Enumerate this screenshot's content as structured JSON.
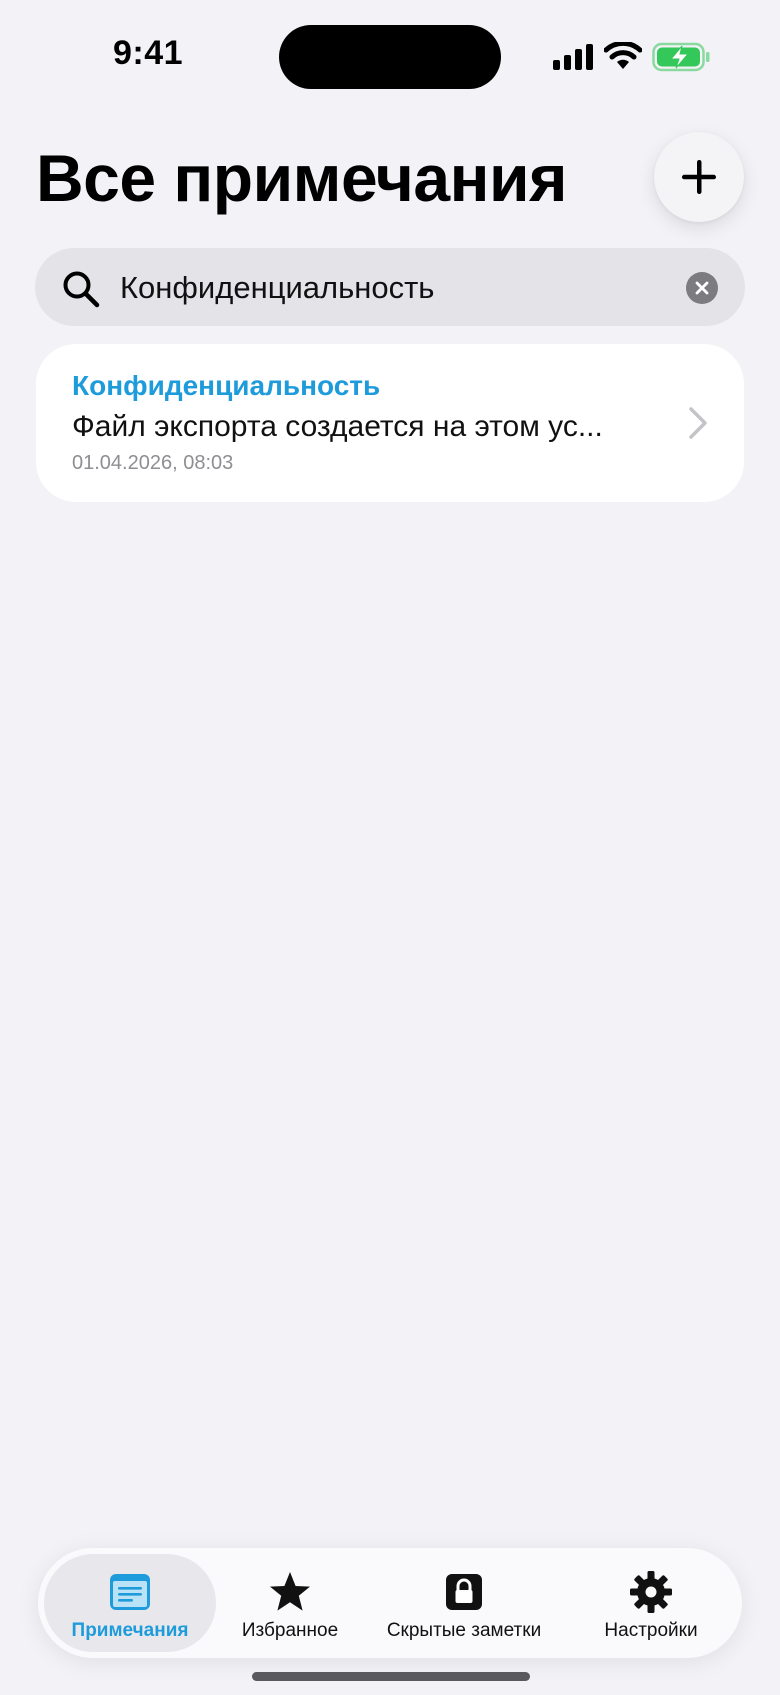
{
  "status_bar": {
    "time": "9:41"
  },
  "header": {
    "title": "Все примечания"
  },
  "search": {
    "value": "Конфиденциальность",
    "placeholder": ""
  },
  "results": [
    {
      "title": "Конфиденциальность",
      "snippet": "Файл экспорта создается на этом ус...",
      "date": "01.04.2026, 08:03"
    }
  ],
  "tab_bar": {
    "tabs": [
      {
        "label": "Примечания",
        "icon": "notes-icon",
        "active": true
      },
      {
        "label": "Избранное",
        "icon": "star-icon",
        "active": false
      },
      {
        "label": "Скрытые заметки",
        "icon": "lock-icon",
        "active": false
      },
      {
        "label": "Настройки",
        "icon": "gear-icon",
        "active": false
      }
    ]
  },
  "colors": {
    "accent": "#1E9BDB",
    "background": "#F2F2F7",
    "battery_green": "#34C759"
  }
}
